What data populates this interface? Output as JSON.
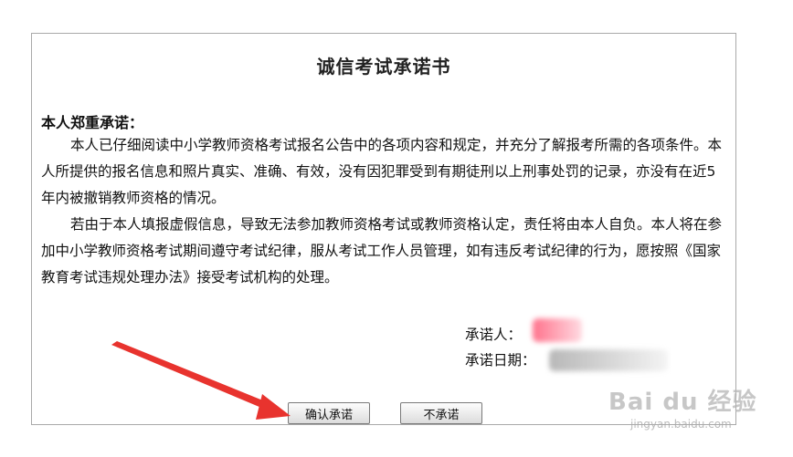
{
  "document": {
    "title": "诚信考试承诺书",
    "heading": "本人郑重承诺：",
    "paragraph_1": "本人已仔细阅读中小学教师资格考试报名公告中的各项内容和规定，并充分了解报考所需的各项条件。本人所提供的报名信息和照片真实、准确、有效，没有因犯罪受到有期徒刑以上刑事处罚的记录，亦没有在近5年内被撤销教师资格的情况。",
    "paragraph_2": "若由于本人填报虚假信息，导致无法参加教师资格考试或教师资格认定，责任将由本人自负。本人将在参加中小学教师资格考试期间遵守考试纪律，服从考试工作人员管理，如有违反考试纪律的行为，愿按照《国家教育考试违规处理办法》接受考试机构的处理。",
    "promiser_label": "承诺人：",
    "date_label": "承诺日期："
  },
  "buttons": {
    "confirm": "确认承诺",
    "decline": "不承诺"
  },
  "watermark": {
    "brand": "Bai du 经验",
    "url": "jingyan.baidu.com"
  },
  "colors": {
    "arrow": "#e8332e",
    "border": "#a9a9a9"
  }
}
